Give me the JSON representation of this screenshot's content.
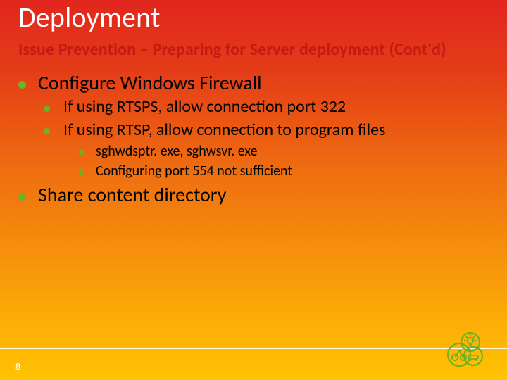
{
  "title": "Deployment",
  "subtitle": "Issue Prevention – Preparing for Server deployment (Cont'd)",
  "bullets": {
    "a": "Configure Windows Firewall",
    "a1": "If using RTSPS, allow connection port 322",
    "a2": "If using RTSP, allow connection to program files",
    "a2i": "sghwdsptr. exe, sghwsvr. exe",
    "a2ii": "Configuring port 554 not sufficient",
    "b": "Share content directory"
  },
  "page_number": "8",
  "colors": {
    "bullet": "#6fb123",
    "subtitle": "#c31a14",
    "grad_top": "#e2261e",
    "grad_bottom": "#ffc300"
  }
}
